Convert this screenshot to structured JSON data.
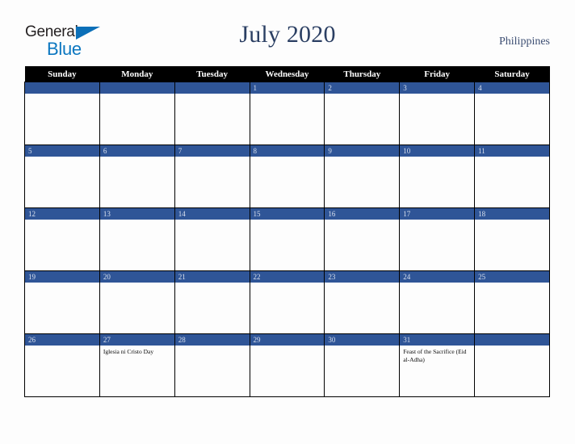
{
  "brand": {
    "name_part1": "General",
    "name_part2": "Blue",
    "triangle_icon": "blue-triangle-icon",
    "color_dark": "#231f20",
    "color_blue": "#0c77c0"
  },
  "header": {
    "title": "July 2020",
    "country": "Philippines",
    "title_color": "#2b3f63"
  },
  "calendar": {
    "accent_color": "#2f5597",
    "header_bg": "#000000",
    "weekday_headers": [
      "Sunday",
      "Monday",
      "Tuesday",
      "Wednesday",
      "Thursday",
      "Friday",
      "Saturday"
    ],
    "weeks": [
      [
        {
          "day": "",
          "event": ""
        },
        {
          "day": "",
          "event": ""
        },
        {
          "day": "",
          "event": ""
        },
        {
          "day": "1",
          "event": ""
        },
        {
          "day": "2",
          "event": ""
        },
        {
          "day": "3",
          "event": ""
        },
        {
          "day": "4",
          "event": ""
        }
      ],
      [
        {
          "day": "5",
          "event": ""
        },
        {
          "day": "6",
          "event": ""
        },
        {
          "day": "7",
          "event": ""
        },
        {
          "day": "8",
          "event": ""
        },
        {
          "day": "9",
          "event": ""
        },
        {
          "day": "10",
          "event": ""
        },
        {
          "day": "11",
          "event": ""
        }
      ],
      [
        {
          "day": "12",
          "event": ""
        },
        {
          "day": "13",
          "event": ""
        },
        {
          "day": "14",
          "event": ""
        },
        {
          "day": "15",
          "event": ""
        },
        {
          "day": "16",
          "event": ""
        },
        {
          "day": "17",
          "event": ""
        },
        {
          "day": "18",
          "event": ""
        }
      ],
      [
        {
          "day": "19",
          "event": ""
        },
        {
          "day": "20",
          "event": ""
        },
        {
          "day": "21",
          "event": ""
        },
        {
          "day": "22",
          "event": ""
        },
        {
          "day": "23",
          "event": ""
        },
        {
          "day": "24",
          "event": ""
        },
        {
          "day": "25",
          "event": ""
        }
      ],
      [
        {
          "day": "26",
          "event": ""
        },
        {
          "day": "27",
          "event": "Iglesia ni Cristo Day"
        },
        {
          "day": "28",
          "event": ""
        },
        {
          "day": "29",
          "event": ""
        },
        {
          "day": "30",
          "event": ""
        },
        {
          "day": "31",
          "event": "Feast of the Sacrifice (Eid al-Adha)"
        },
        {
          "day": "",
          "event": ""
        }
      ]
    ]
  }
}
